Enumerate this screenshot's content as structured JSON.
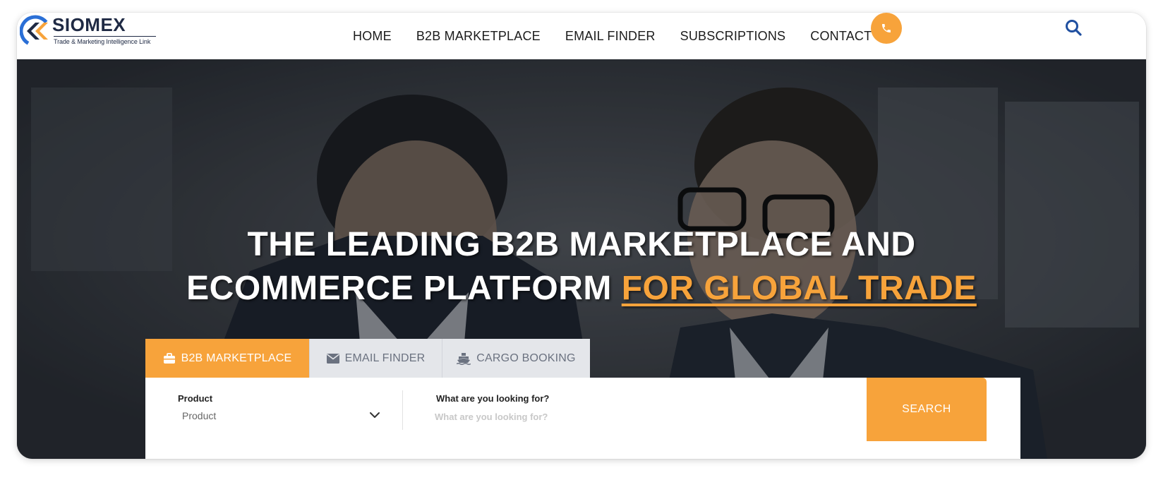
{
  "brand": {
    "name": "SIOMEX",
    "tagline": "Trade & Marketing Intelligence Link",
    "colors": {
      "accent": "#f7a33b",
      "navy": "#1f2a44",
      "blue": "#2a6fd6"
    }
  },
  "nav": {
    "items": [
      {
        "label": "HOME"
      },
      {
        "label": "B2B MARKETPLACE"
      },
      {
        "label": "EMAIL FINDER"
      },
      {
        "label": "SUBSCRIPTIONS"
      },
      {
        "label": "CONTACT US"
      }
    ],
    "phone_icon": "phone-icon",
    "search_icon": "search-icon"
  },
  "hero": {
    "title_line1": "THE LEADING B2B MARKETPLACE AND",
    "title_line2_plain": "ECOMMERCE PLATFORM ",
    "title_line2_accent": "FOR GLOBAL TRADE"
  },
  "tabs": [
    {
      "label": "B2B MARKETPLACE",
      "icon": "briefcase-icon",
      "active": true
    },
    {
      "label": "EMAIL FINDER",
      "icon": "envelope-icon",
      "active": false
    },
    {
      "label": "CARGO BOOKING",
      "icon": "ship-icon",
      "active": false
    }
  ],
  "search": {
    "product_label": "Product",
    "product_value": "Product",
    "query_label": "What are you looking for?",
    "query_placeholder": "What are you looking for?",
    "button_label": "SEARCH"
  }
}
